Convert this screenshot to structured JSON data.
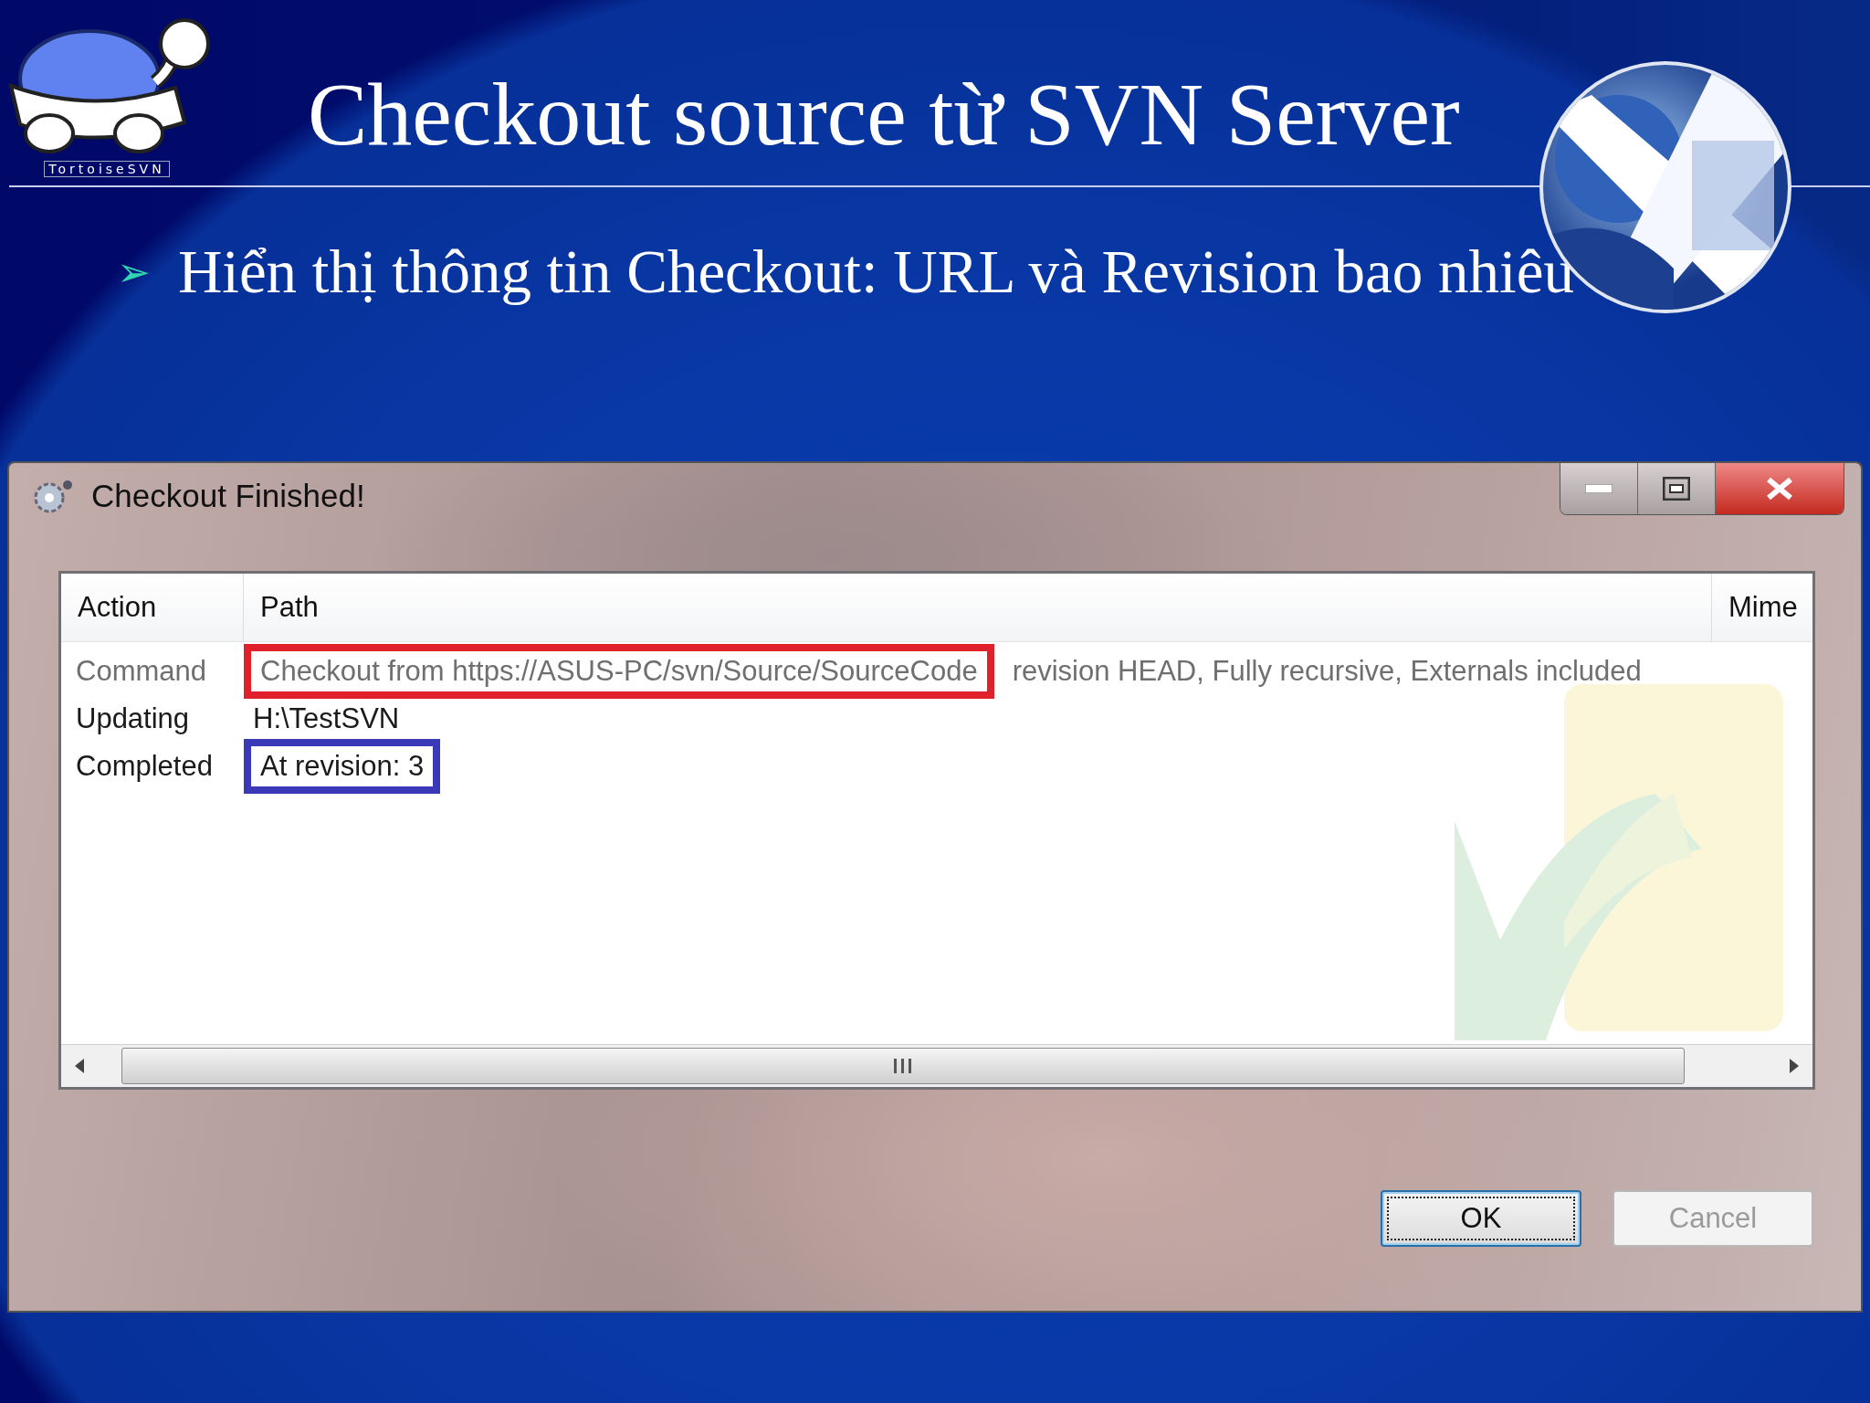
{
  "slide": {
    "logo_caption": "TortoiseSVN",
    "title": "Checkout source từ SVN Server",
    "bullets": [
      {
        "marker": "➢",
        "text": "Hiển thị thông tin Checkout: URL và Revision bao nhiêu"
      }
    ]
  },
  "dialog": {
    "title": "Checkout Finished!",
    "columns": [
      "Action",
      "Path",
      "Mime"
    ],
    "rows": [
      {
        "kind": "command",
        "action": "Command",
        "path": [
          {
            "text": "Checkout from https://ASUS-PC/svn/Source/SourceCode",
            "color": "#e0202a"
          },
          {
            "text": "revision HEAD, Fully recursive, Externals included"
          }
        ]
      },
      {
        "kind": "normal",
        "action": "Updating",
        "path": [
          {
            "text": "H:\\TestSVN"
          }
        ]
      },
      {
        "kind": "normal",
        "action": "Completed",
        "path": [
          {
            "text": "At revision: 3",
            "color": "#3a3ab8"
          }
        ]
      }
    ],
    "buttons": [
      {
        "label": "OK",
        "disabled": false
      },
      {
        "label": "Cancel",
        "disabled": true
      }
    ]
  }
}
